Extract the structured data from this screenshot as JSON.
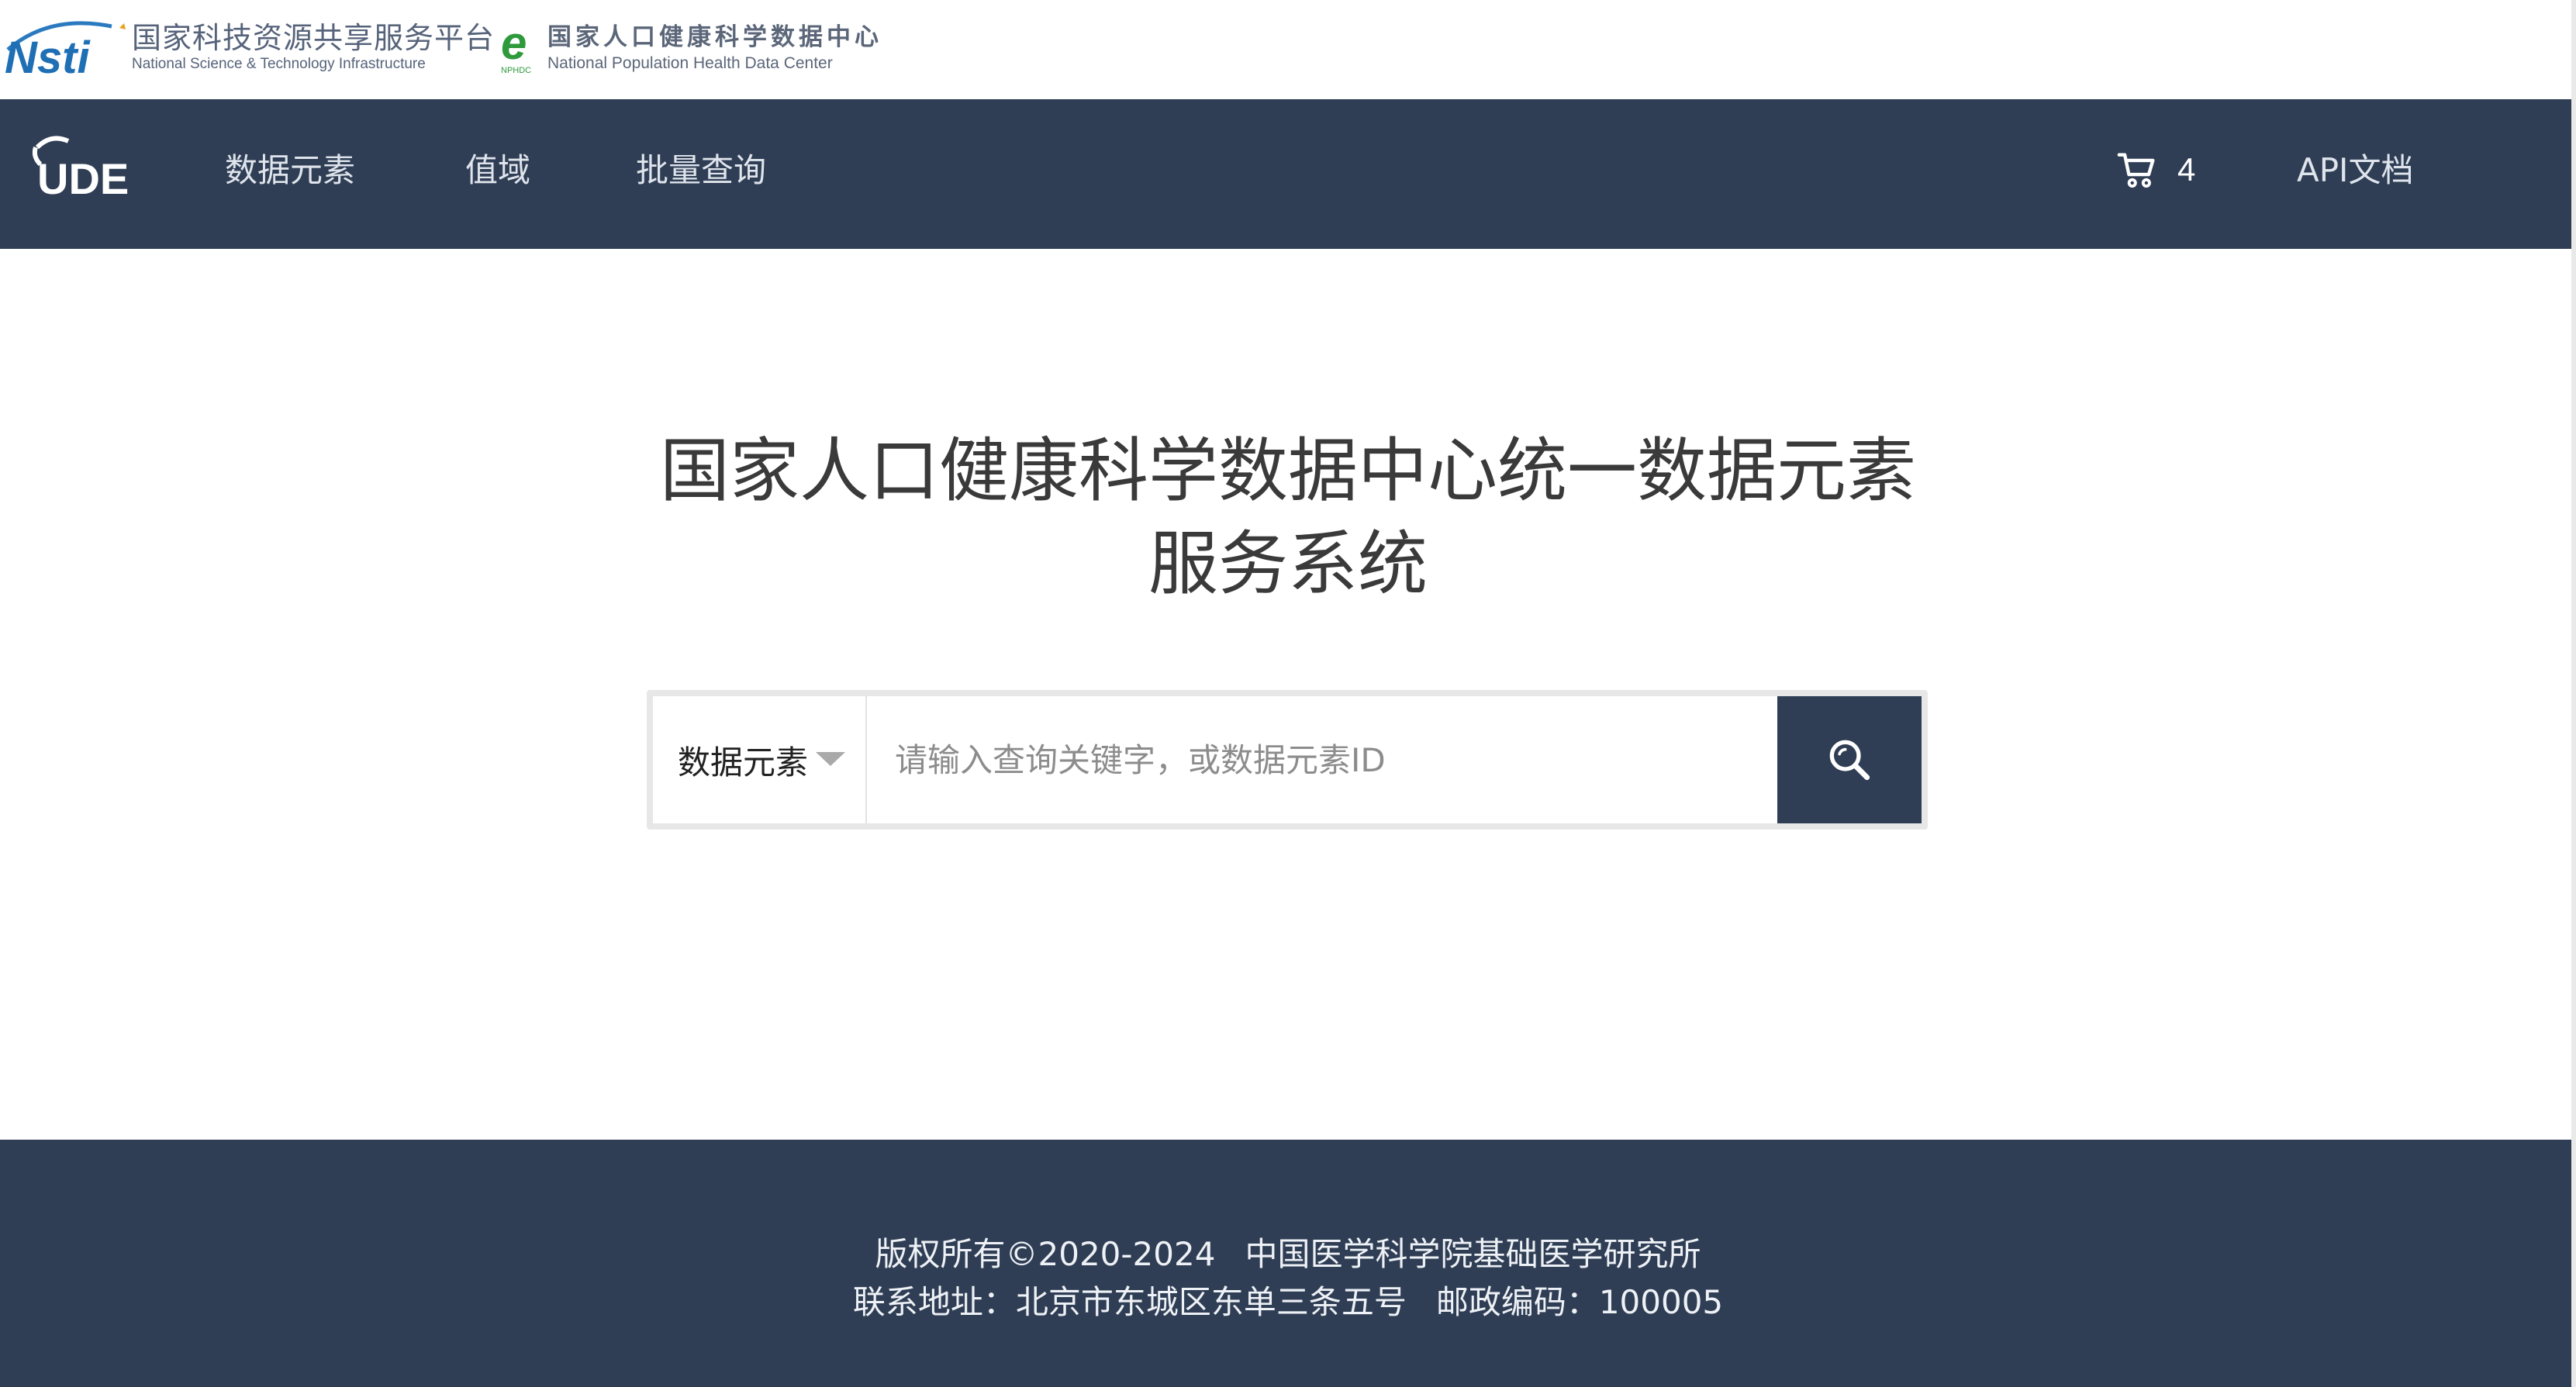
{
  "header": {
    "nsti_logo_text": "Nsti",
    "nsti_name_cn": "国家科技资源共享服务平台",
    "nsti_name_en": "National Science & Technology Infrastructure",
    "nphdc_name_cn": "国家人口健康科学数据中心",
    "nphdc_name_en": "National Population Health Data Center",
    "nphdc_logo_small": "NPHDC"
  },
  "nav": {
    "logo_text": "UDE",
    "items": [
      {
        "label": "数据元素"
      },
      {
        "label": "值域"
      },
      {
        "label": "批量查询"
      }
    ],
    "cart_count": "4",
    "api_doc": "API文档"
  },
  "main": {
    "title_line1": "国家人口健康科学数据中心统一数据元素",
    "title_line2": "服务系统"
  },
  "search": {
    "type_selected": "数据元素",
    "placeholder": "请输入查询关键字，或数据元素ID"
  },
  "footer": {
    "copyright": "版权所有©2020-2024",
    "institute": "中国医学科学院基础医学研究所",
    "address": "联系地址：北京市东城区东单三条五号",
    "postcode": "邮政编码：100005"
  },
  "colors": {
    "nav_bg": "#2f3e55",
    "footer_bg": "#2f3e55",
    "nsti_blue": "#1f6fb5",
    "nphdc_green": "#2e9a3c"
  }
}
